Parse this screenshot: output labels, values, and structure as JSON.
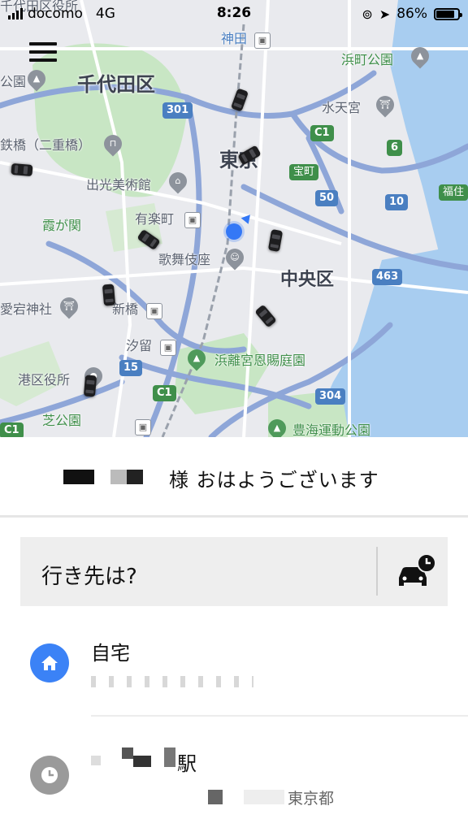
{
  "status_bar": {
    "carrier": "docomo",
    "network": "4G",
    "time": "8:26",
    "battery_percent": "86%"
  },
  "map": {
    "wards": [
      "千代田区",
      "東京",
      "中央区"
    ],
    "places": {
      "kanda": "神田",
      "hamacho_park": "浜町公園",
      "suitengu": "水天宮",
      "nijubashi": "鉄橋（二重橋）",
      "idemitsu": "出光美術館",
      "kasumigaseki": "霞が関",
      "yurakucho": "有楽町",
      "kabukiza": "歌舞伎座",
      "takaracho": "宝町",
      "fukugawa": "福住",
      "atago": "愛宕神社",
      "shinbashi": "新橋",
      "shiodome": "汐留",
      "hamarikyu": "浜離宮恩賜庭園",
      "minato_office": "港区役所",
      "shiba_park": "芝公園",
      "toyomi": "豊海運動公園",
      "koen_left": "公園",
      "chiyoda_top": "千代田区役所"
    },
    "route_shields": [
      "301",
      "C1",
      "6",
      "50",
      "10",
      "463",
      "15",
      "C1",
      "304",
      "C1"
    ],
    "accent_blue": "#3478f6"
  },
  "greeting": {
    "text": "様 おはようございます"
  },
  "search": {
    "placeholder": "行き先は?"
  },
  "saved_places": [
    {
      "title": "自宅",
      "icon": "home-icon",
      "color": "#3b82f6"
    },
    {
      "title": "駅",
      "subtitle": "東京都",
      "icon": "clock-icon",
      "color": "#9a9a9a"
    }
  ]
}
